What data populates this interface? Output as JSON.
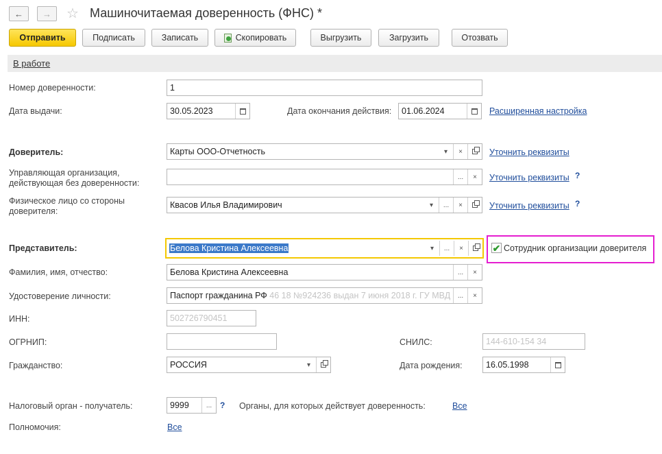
{
  "window": {
    "title": "Машиночитаемая доверенность (ФНС) *"
  },
  "toolbar": {
    "send": "Отправить",
    "sign": "Подписать",
    "save": "Записать",
    "copy": "Скопировать",
    "export": "Выгрузить",
    "import": "Загрузить",
    "revoke": "Отозвать"
  },
  "status": {
    "label": "В работе"
  },
  "form": {
    "number_label": "Номер доверенности:",
    "number_value": "1",
    "issue_date_label": "Дата выдачи:",
    "issue_date_value": "30.05.2023",
    "end_date_label": "Дата окончания действия:",
    "end_date_value": "01.06.2024",
    "advanced_link": "Расширенная настройка",
    "principal_label": "Доверитель:",
    "principal_value": "Карты ООО-Отчетность",
    "clarify_link": "Уточнить реквизиты",
    "managing_org_label_1": "Управляющая организация,",
    "managing_org_label_2": "действующая без доверенности:",
    "managing_org_value": "",
    "person_label_1": "Физическое лицо со стороны",
    "person_label_2": "доверителя:",
    "person_value": "Квасов Илья Владимирович",
    "help": "?",
    "representative_label": "Представитель:",
    "representative_value": "Белова Кристина Алексеевна",
    "employee_checkbox_label": "Сотрудник организации доверителя",
    "employee_checked": true,
    "fio_label": "Фамилия, имя, отчество:",
    "fio_value": "Белова Кристина Алексеевна",
    "id_doc_label": "Удостоверение личности:",
    "id_doc_value_main": "Паспорт гражданина РФ",
    "id_doc_value_rest": " 46 18 №924236 выдан 7 июня 2018 г. ГУ МВД",
    "inn_label": "ИНН:",
    "inn_value": "502726790451",
    "ogrnip_label": "ОГРНИП:",
    "ogrnip_value": "",
    "snils_label": "СНИЛС:",
    "snils_value": "144-610-154 34",
    "citizenship_label": "Гражданство:",
    "citizenship_value": "РОССИЯ",
    "birth_date_label": "Дата рождения:",
    "birth_date_value": "16.05.1998",
    "tax_office_label": "Налоговый орган - получатель:",
    "tax_office_value": "9999",
    "bodies_label": "Органы, для которых действует доверенность:",
    "bodies_link": "Все",
    "powers_label": "Полномочия:",
    "powers_link": "Все"
  },
  "icons": {
    "dropdown": "▾",
    "more": "...",
    "clear": "×"
  }
}
